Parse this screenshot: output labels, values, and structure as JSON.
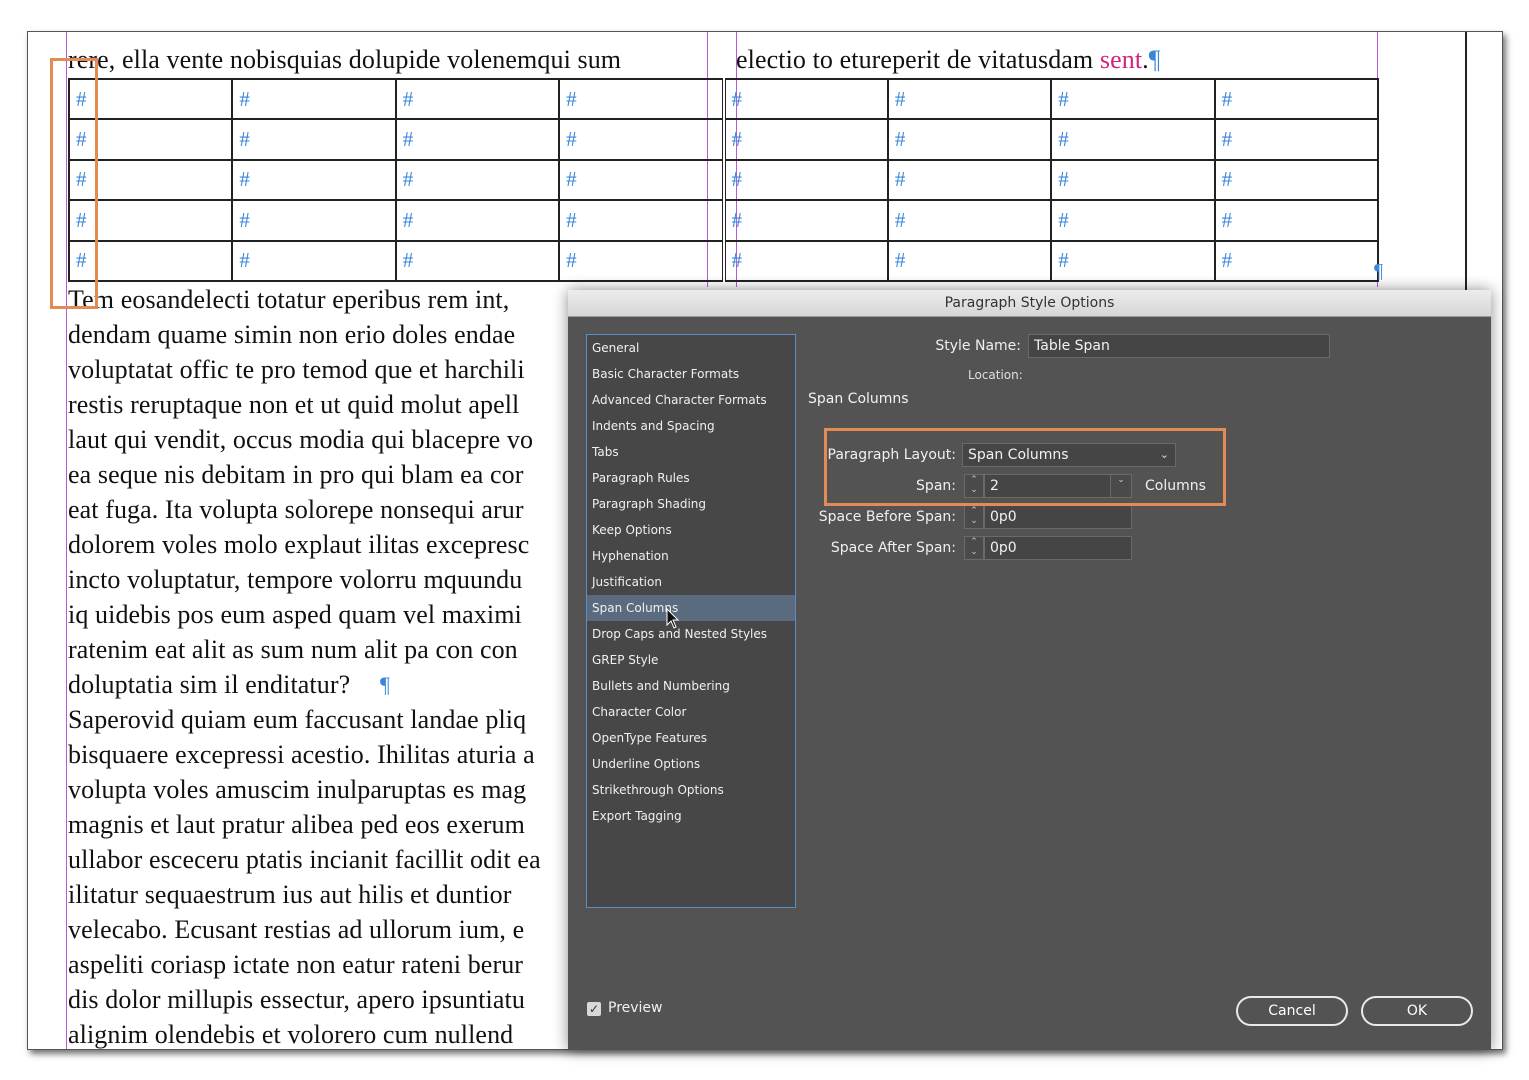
{
  "document": {
    "top_partial_left": "rere, ella vente nobisquias dolupide volenemqui sum",
    "top_partial_right": "electio to etureperit de vitatusdam",
    "top_partial_right_pink": "sent",
    "top_partial_right_end": ".",
    "pilcrow": "¶",
    "table_cell_marker": "#",
    "body_lines": [
      "Tem eosandelecti totatur eperibus rem int,",
      "dendam quame simin non erio doles endae",
      "voluptatat offic te pro temod que et harchili",
      "restis reruptaque non et ut quid molut apell",
      "laut qui vendit, occus modia qui blacepre vo",
      "ea seque nis debitam in pro qui blam ea cor",
      "eat fuga. Ita volupta solorepe nonsequi arur",
      "dolorem voles molo explaut ilitas excepresc",
      "incto voluptatur, tempore volorru mquundu",
      "iq uidebis pos eum asped quam vel maximi",
      "ratenim eat alit as sum num alit pa con con",
      "doluptatia sim il enditatur?",
      "Saperovid quiam eum faccusant landae pliq",
      "bisquaere excepressi acestio. Ihilitas aturia a",
      "volupta voles amuscim inulparuptas es mag",
      "magnis et laut pratur alibea ped eos exerum",
      "ullabor esceceru ptatis incianit facillit odit ea",
      "ilitatur sequaestrum ius aut hilis et duntior",
      "velecabo. Ecusant restias ad ullorum ium, e",
      "aspeliti coriasp ictate non eatur rateni berur",
      "dis dolor millupis essectur, apero ipsuntiatu",
      "alignim olendebis et volorero cum nullend"
    ]
  },
  "dialog": {
    "title": "Paragraph Style Options",
    "categories": [
      "General",
      "Basic Character Formats",
      "Advanced Character Formats",
      "Indents and Spacing",
      "Tabs",
      "Paragraph Rules",
      "Paragraph Shading",
      "Keep Options",
      "Hyphenation",
      "Justification",
      "Span Columns",
      "Drop Caps and Nested Styles",
      "GREP Style",
      "Bullets and Numbering",
      "Character Color",
      "OpenType Features",
      "Underline Options",
      "Strikethrough Options",
      "Export Tagging"
    ],
    "selected_category": "Span Columns",
    "style_name_label": "Style Name:",
    "style_name_value": "Table Span",
    "location_label": "Location:",
    "section_title": "Span Columns",
    "paragraph_layout_label": "Paragraph Layout:",
    "paragraph_layout_value": "Span Columns",
    "span_label": "Span:",
    "span_value": "2",
    "span_unit": "Columns",
    "space_before_label": "Space Before Span:",
    "space_before_value": "0p0",
    "space_after_label": "Space After Span:",
    "space_after_value": "0p0",
    "preview_label": "Preview",
    "preview_checked": true,
    "cancel_label": "Cancel",
    "ok_label": "OK"
  },
  "colors": {
    "highlight": "#e38b55",
    "guide": "#b65ad6",
    "marker": "#3b86d9",
    "dialog_bg": "#535353"
  }
}
